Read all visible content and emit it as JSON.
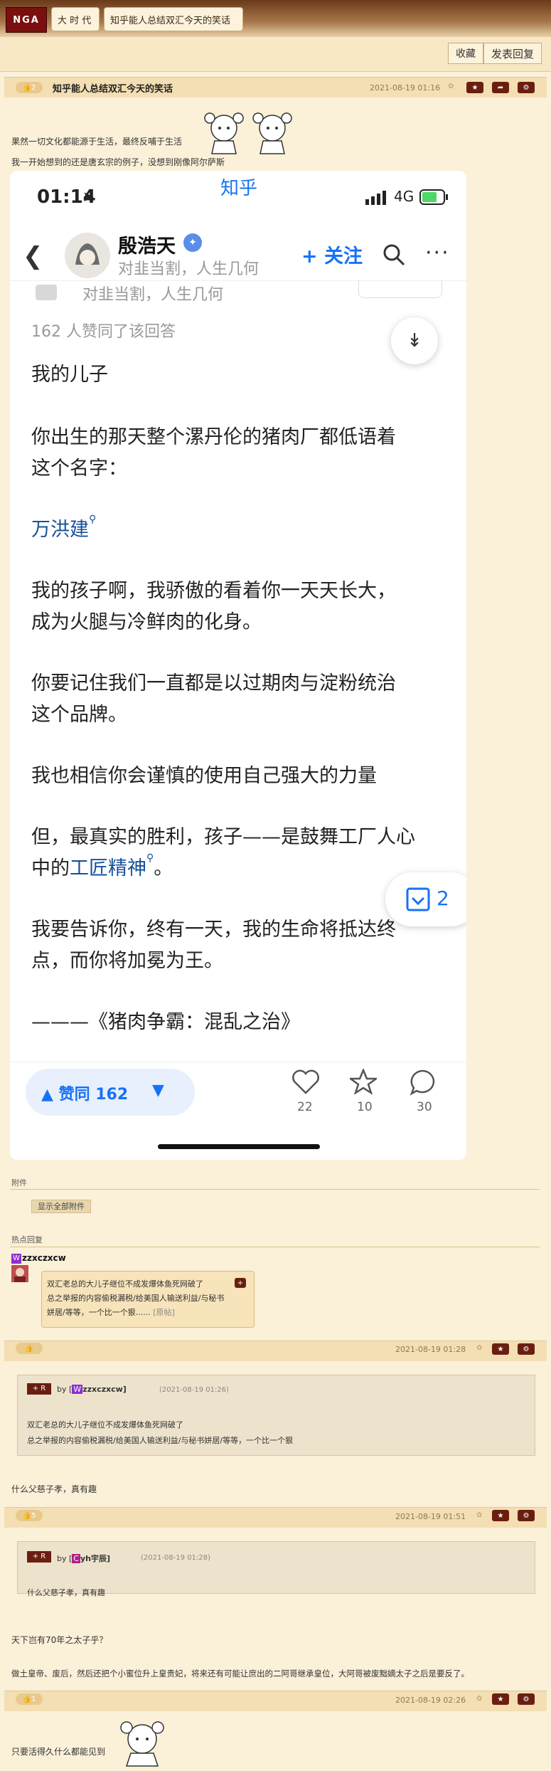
{
  "topbar": {
    "logo": "NGA",
    "crumbs": [
      "大 时 代",
      "知乎能人总结双汇今天的笑话"
    ]
  },
  "actions": {
    "favorite": "收藏",
    "reply": "发表回复"
  },
  "post0": {
    "likes": "2",
    "title": "知乎能人总结双汇今天的笑话",
    "date": "2021-08-19 01:16",
    "line1": "果然一切文化都能源于生活，最终反哺于生活",
    "line2": "我一开始想到的还是唐玄宗的例子，没想到刚像阿尔萨斯"
  },
  "zhihu": {
    "time": "01:14",
    "app_title": "知乎",
    "network": "4G",
    "author": "殷浩天",
    "author_sub": "对韭当割，人生几何",
    "follow": "+ 关注",
    "agree_count_text": "162 人赞同了该回答",
    "paragraphs": [
      "我的儿子",
      "你出生的那天整个漯丹伦的猪肉厂都低语着",
      "这个名字：",
      "万洪建",
      "我的孩子啊，我骄傲的看着你一天天长大，",
      "成为火腿与冷鲜肉的化身。",
      "你要记住我们一直都是以过期肉与淀粉统治",
      "这个品牌。",
      "我也相信你会谨慎的使用自己强大的力量",
      "但，最真实的胜利，孩子——是鼓舞工厂人心",
      "中的",
      "工匠精神",
      "。",
      "我要告诉你，终有一天，我的生命将抵达终",
      "点，而你将加冕为王。",
      "———《猪肉争霸：混乱之治》"
    ],
    "comment_float": "2",
    "vote_label": "赞同 162",
    "likes": "22",
    "stars": "10",
    "comments": "30",
    "colors": {
      "blue": "#1772f6",
      "link": "#175199"
    }
  },
  "attachments": {
    "label": "附件",
    "show_all": "显示全部附件"
  },
  "hot": {
    "label": "热点回复",
    "user": "zzxczxcw",
    "user_initial": "W",
    "text1": "双汇老总的大儿子继位不成发爆体鱼死网破了",
    "text2": "总之举报的内容偷税漏税/给美国人输送利益/与秘书",
    "text3": "姘居/等等，一个比一个狠......",
    "more": "[原帖]",
    "plus": "+"
  },
  "post1": {
    "date": "2021-08-19 01:28",
    "q_by": "by [",
    "q_user": "zzxczxcw]",
    "q_user_initial": "W",
    "q_date": "(2021-08-19 01:26)",
    "q_line1": "双汇老总的大儿子继位不成发爆体鱼死网破了",
    "q_line2": "总之举报的内容偷税漏税/给美国人输送利益/与秘书姘居/等等，一个比一个狠",
    "body": "什么父慈子孝，真有趣"
  },
  "post2": {
    "likes": "5",
    "date": "2021-08-19 01:51",
    "q_by": "by [",
    "q_user": "yh宇辰]",
    "q_user_initial": "C",
    "q_date": "(2021-08-19 01:28)",
    "q_line1": "什么父慈子孝，真有趣",
    "body1": "天下岂有70年之太子乎？",
    "body2": "做土皇帝、废后，然后还把个小蜜位升上皇贵妃，将来还有可能让庶出的二阿哥继承皇位，大阿哥被废黜嫡太子之后是要反了。"
  },
  "post3": {
    "likes": "1",
    "date": "2021-08-19 02:26",
    "body": "只要活得久什么都能见到"
  }
}
